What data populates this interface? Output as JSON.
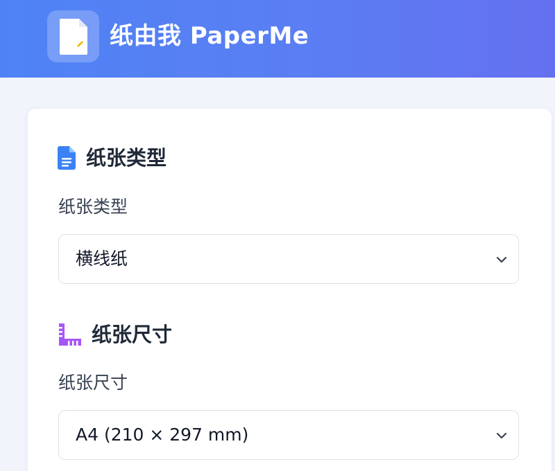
{
  "app": {
    "title": "纸由我 PaperMe"
  },
  "sections": [
    {
      "icon": "document-icon",
      "title": "纸张类型",
      "field_label": "纸张类型",
      "selected_value": "横线纸",
      "icon_color": "#3b82f6"
    },
    {
      "icon": "ruler-icon",
      "title": "纸张尺寸",
      "field_label": "纸张尺寸",
      "selected_value": "A4 (210 × 297 mm)",
      "icon_color": "#a855f7"
    }
  ],
  "colors": {
    "header_start": "#4f83f5",
    "header_end": "#6570f0",
    "page_bg": "#f1f4fb"
  }
}
